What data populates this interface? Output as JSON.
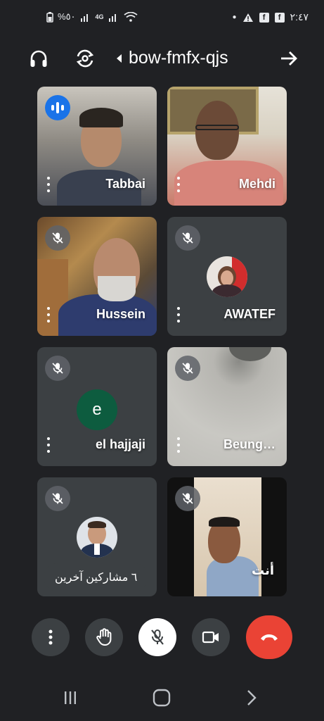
{
  "status_bar": {
    "battery": "%٥٠",
    "signal_label": "4G",
    "time": "٢:٤٧"
  },
  "top_bar": {
    "meeting_code": "bow-fmfx-qjs"
  },
  "participants": [
    {
      "name": "Tabbai",
      "state": "speaking"
    },
    {
      "name": "Mehdi",
      "state": "unmuted"
    },
    {
      "name": "Hussein",
      "state": "muted"
    },
    {
      "name": "AWATEF",
      "state": "muted"
    },
    {
      "name": "el hajjaji",
      "state": "muted",
      "avatar_letter": "e"
    },
    {
      "name": "Beung…",
      "state": "muted"
    },
    {
      "name": "",
      "state": "muted"
    },
    {
      "name": "أنت",
      "state": "muted"
    }
  ],
  "others_label": "٦ مشاركين آخرين",
  "colors": {
    "background": "#202124",
    "tile": "#3c4043",
    "end_call": "#ea4335",
    "speaking": "#1a73e8",
    "letter_avatar": "#0d5c3f"
  },
  "icons": {
    "top": [
      "headphones-icon",
      "switch-camera-icon",
      "caret-left-icon",
      "arrow-right-icon"
    ],
    "controls": [
      "more-options-icon",
      "raise-hand-icon",
      "mic-off-icon",
      "camera-icon",
      "end-call-icon"
    ],
    "nav": [
      "recent-apps-icon",
      "home-icon",
      "back-icon"
    ]
  }
}
